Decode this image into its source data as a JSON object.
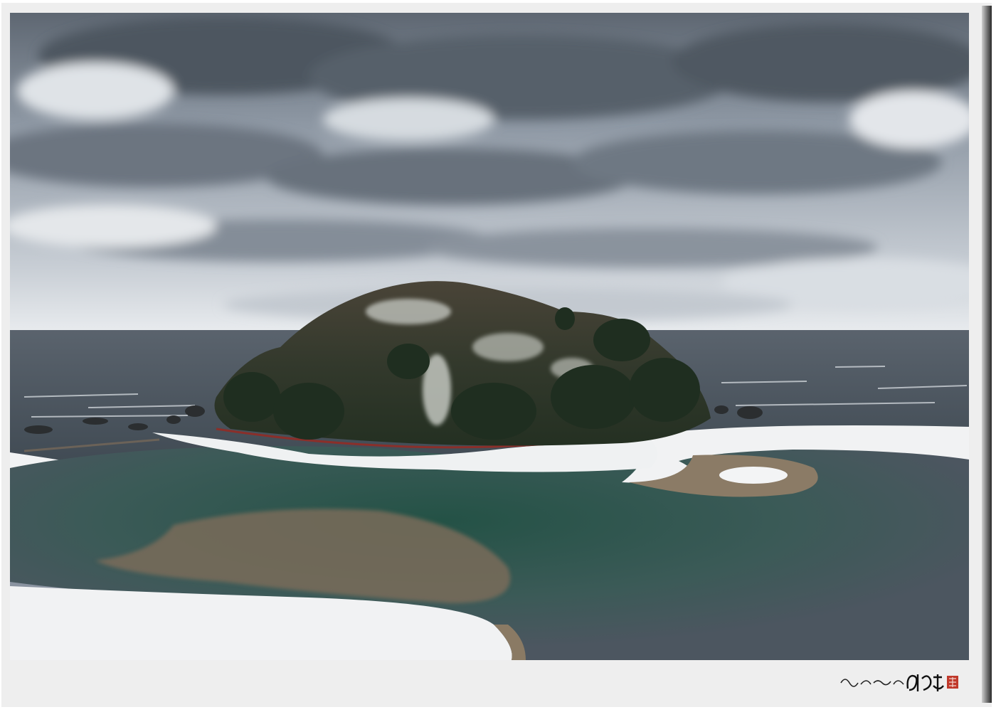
{
  "photo": {
    "subject": "snow-covered-islet-landscape",
    "palette": {
      "sky_light": "#e9ecef",
      "sky_dark": "#5b6470",
      "sea": "#4b5560",
      "snow": "#f4f5f6",
      "sand": "#8a7a66",
      "lagoon_green": "#2f5d52",
      "lagoon_gray": "#4e5760",
      "forest": "#2c3a2c",
      "walkway_red": "#8a2f2a"
    }
  },
  "signature": {
    "kind": "handwritten-calligraphy-signature",
    "text": "새로운 세상 임현규",
    "seal_color": "#c0392b"
  }
}
